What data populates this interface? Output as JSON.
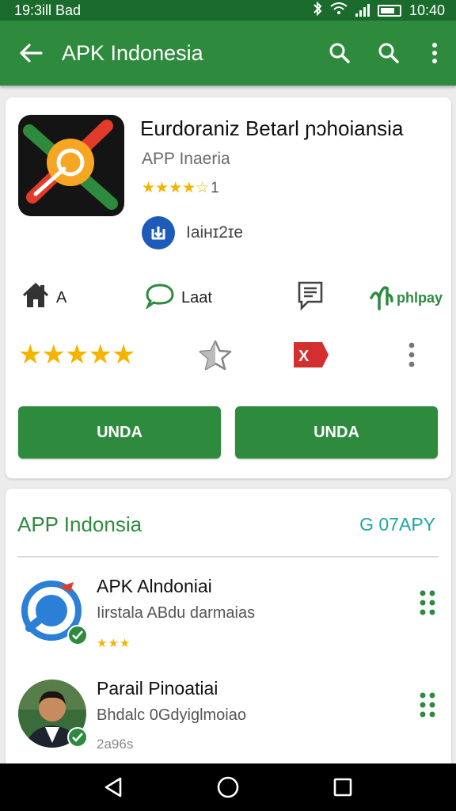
{
  "status_bar": {
    "left_text": "19:3ill Bad",
    "time": "10:40"
  },
  "app_bar": {
    "title": "APK Indonesia",
    "icons": [
      "back-arrow-icon",
      "search-icon",
      "search-icon",
      "more-vert-icon"
    ]
  },
  "app": {
    "title": "Eurdoraniz Betarl ɲɔhoiansia",
    "developer_sub": "APP Inaeria",
    "rating_count": "1",
    "dev_name": "Iaiʜɪ2ɪe",
    "stars_small": "★★★★☆"
  },
  "info_row": [
    {
      "icon": "home-icon",
      "label": "A"
    },
    {
      "icon": "chat-bubble-icon",
      "label": "Laat"
    },
    {
      "icon": "comment-icon",
      "label": ""
    },
    {
      "icon": "brand-icon",
      "label": "phlpay"
    }
  ],
  "rating_row": {
    "stars": "★★★★★",
    "icons": [
      "star-outline-icon",
      "flag-icon",
      "more-vert-icon"
    ],
    "flag_text": "X"
  },
  "buttons": {
    "left_label": "UNDA",
    "right_label": "UNDA"
  },
  "section": {
    "title": "APP Indonsia",
    "link": "G 07APY",
    "items": [
      {
        "name": "APK Alndoniai",
        "desc": "Iirstala ABdu darmaias",
        "meta": "★★★"
      },
      {
        "name": "Parail Pinoatiai",
        "desc": "Bhdalc 0Gdyiglmoiao",
        "meta": "2a96s"
      }
    ]
  },
  "colors": {
    "primary": "#2e8b3e",
    "status_bar": "#1b6b2c",
    "star": "#f4b400",
    "link": "#1ea7a0"
  }
}
